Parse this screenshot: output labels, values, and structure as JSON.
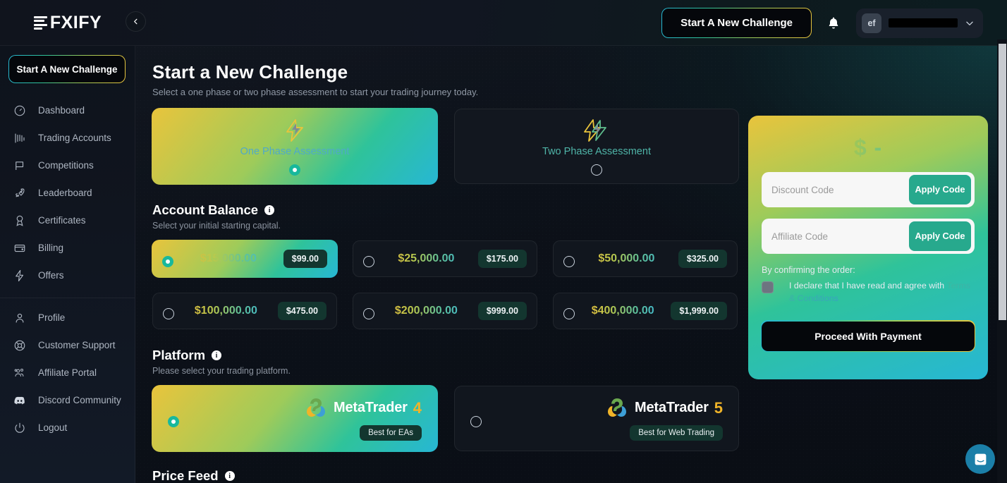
{
  "brand": {
    "name": "FXIFY"
  },
  "header": {
    "new_challenge_label": "Start A New Challenge",
    "avatar_initials": "ef",
    "username": "",
    "bell_icon": "bell-icon",
    "chevron_icon": "chevron-down-icon"
  },
  "sidebar": {
    "cta_label": "Start A New Challenge",
    "items": [
      {
        "label": "Dashboard",
        "icon": "gauge-icon"
      },
      {
        "label": "Trading Accounts",
        "icon": "candlestick-chart-icon"
      },
      {
        "label": "Competitions",
        "icon": "flag-icon"
      },
      {
        "label": "Leaderboard",
        "icon": "rocket-icon"
      },
      {
        "label": "Certificates",
        "icon": "award-ribbon-icon"
      },
      {
        "label": "Billing",
        "icon": "wallet-icon"
      },
      {
        "label": "Offers",
        "icon": "lightning-bolt-icon"
      }
    ],
    "items_secondary": [
      {
        "label": "Profile",
        "icon": "user-icon"
      },
      {
        "label": "Customer Support",
        "icon": "lifebuoy-icon"
      },
      {
        "label": "Affiliate Portal",
        "icon": "users-group-icon"
      },
      {
        "label": "Discord Community",
        "icon": "discord-icon"
      },
      {
        "label": "Logout",
        "icon": "power-icon"
      }
    ]
  },
  "page": {
    "title": "Start a New Challenge",
    "subtitle": "Select a one phase or two phase assessment to start your trading journey today."
  },
  "phase": {
    "options": [
      {
        "label": "One Phase Assessment",
        "selected": true,
        "icon": "single-bolt-icon"
      },
      {
        "label": "Two Phase Assessment",
        "selected": false,
        "icon": "double-bolt-icon"
      }
    ]
  },
  "account_balance": {
    "title": "Account Balance",
    "subtitle": "Select your initial starting capital.",
    "info_icon": "info-icon",
    "options": [
      {
        "amount": "$15,000.00",
        "price": "$99.00",
        "selected": true
      },
      {
        "amount": "$25,000.00",
        "price": "$175.00",
        "selected": false
      },
      {
        "amount": "$50,000.00",
        "price": "$325.00",
        "selected": false
      },
      {
        "amount": "$100,000.00",
        "price": "$475.00",
        "selected": false
      },
      {
        "amount": "$200,000.00",
        "price": "$999.00",
        "selected": false
      },
      {
        "amount": "$400,000.00",
        "price": "$1,999.00",
        "selected": false
      }
    ]
  },
  "platform": {
    "title": "Platform",
    "subtitle": "Please select your trading platform.",
    "info_icon": "info-icon",
    "options": [
      {
        "name": "MetaTrader",
        "version": "4",
        "badge": "Best for EAs",
        "selected": true
      },
      {
        "name": "MetaTrader",
        "version": "5",
        "badge": "Best for Web Trading",
        "selected": false
      }
    ]
  },
  "price_feed": {
    "title": "Price Feed",
    "info_icon": "info-icon"
  },
  "summary": {
    "price": "$ -",
    "discount_placeholder": "Discount Code",
    "discount_value": "",
    "affiliate_placeholder": "Affiliate Code",
    "affiliate_value": "",
    "apply_label": "Apply Code",
    "confirm_heading": "By confirming the order:",
    "terms_text": "I declare that I have read and agree with ",
    "terms_link": "Terms & Conditions",
    "terms_checked": false,
    "proceed_label": "Proceed With Payment"
  },
  "chat": {
    "icon": "intercom-chat-icon"
  },
  "colors": {
    "accent_gradient_start": "#e9c43c",
    "accent_gradient_mid": "#2fc39a",
    "accent_gradient_end": "#27b7d4",
    "apply_green": "#27a98d",
    "badge_bg": "#13362f",
    "chat_blue": "#1b7fa8"
  }
}
